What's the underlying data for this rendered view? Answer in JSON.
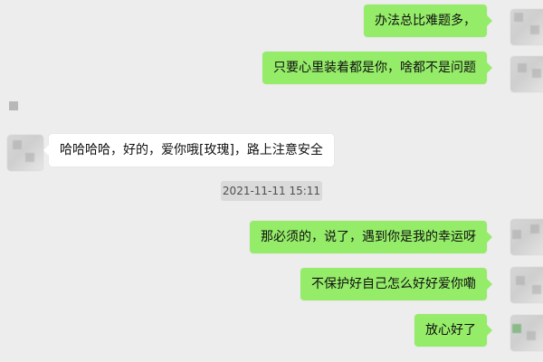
{
  "messages": [
    {
      "id": "m1",
      "side": "right",
      "text": "办法总比难题多，"
    },
    {
      "id": "m2",
      "side": "right",
      "text": "只要心里装着都是你，啥都不是问题"
    },
    {
      "id": "m3",
      "side": "left",
      "text": "哈哈哈哈，好的，爱你哦[玫瑰]，路上注意安全"
    },
    {
      "id": "m4",
      "side": "right",
      "text": "那必须的，说了，遇到你是我的幸运呀"
    },
    {
      "id": "m5",
      "side": "right",
      "text": "不保护好自己怎么好好爱你嘞"
    },
    {
      "id": "m6",
      "side": "right",
      "text": "放心好了"
    }
  ],
  "timestamp": "2021-11-11 15:11",
  "colors": {
    "background": "#ededed",
    "right_bubble": "#95ec69",
    "left_bubble": "#ffffff",
    "timestamp_bg": "#dadada",
    "timestamp_text": "#505050"
  },
  "icons": [
    "avatar",
    "avatar",
    "avatar",
    "avatar",
    "avatar",
    "avatar"
  ]
}
